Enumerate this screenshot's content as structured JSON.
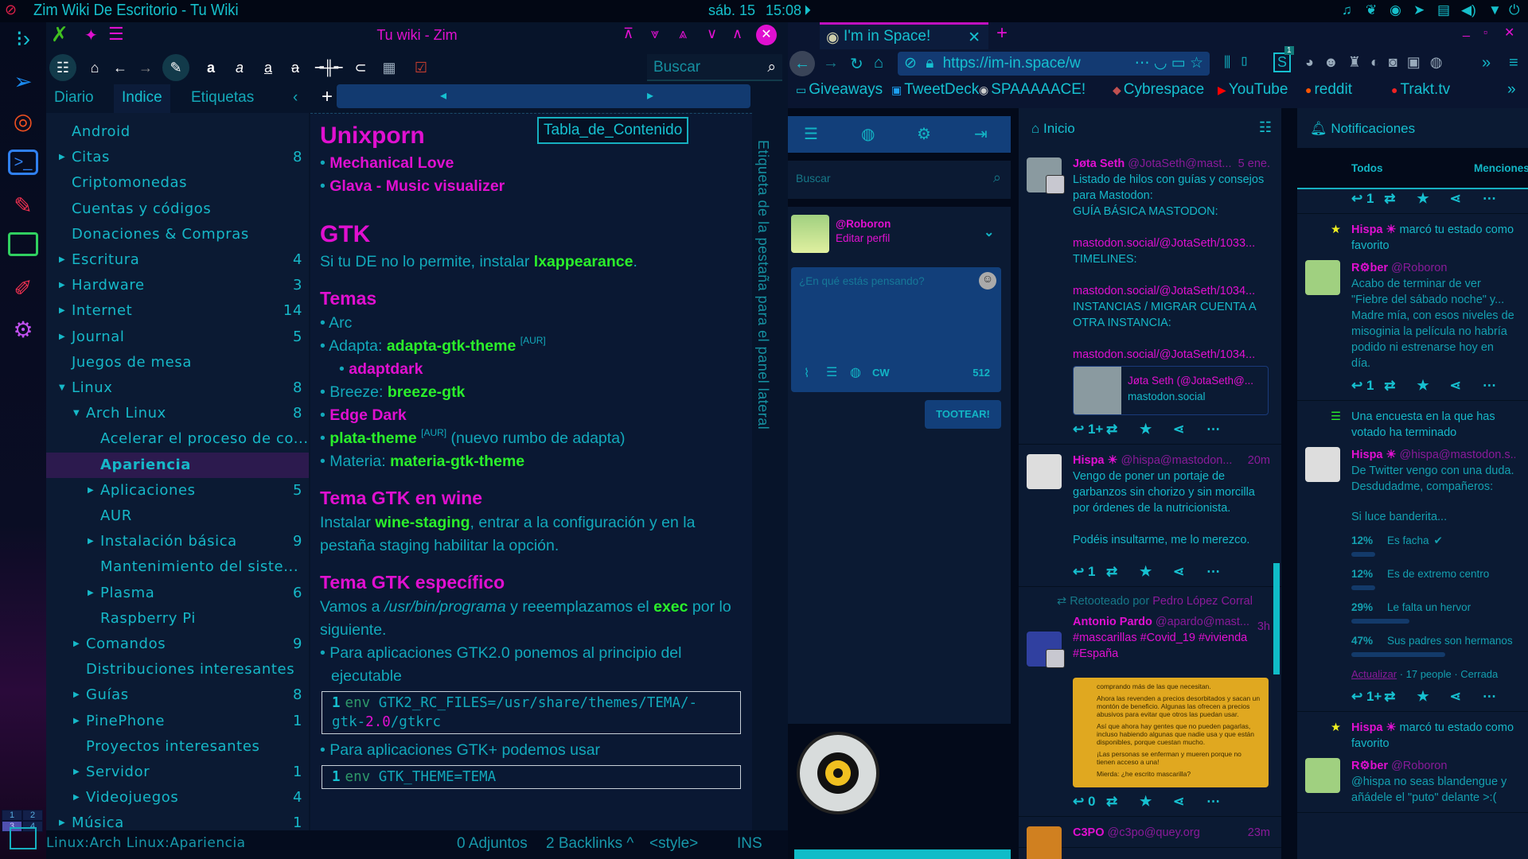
{
  "panel": {
    "window_title": "Zim Wiki De Escritorio - Tu Wiki",
    "date": "sáb. 15",
    "time": "15:08",
    "tray_icons": [
      "bell-icon",
      "feather-icon",
      "steam-icon",
      "telegram-icon",
      "clipboard-icon",
      "volume-icon",
      "network-icon",
      "power-icon"
    ]
  },
  "dock": {
    "icons": [
      "launcher-icon",
      "telegram-icon",
      "firefox-icon",
      "terminal-icon",
      "paint-icon",
      "folder-icon",
      "pencil-icon",
      "settings-icon"
    ],
    "workspaces": [
      "1",
      "2",
      "3",
      "4"
    ],
    "active_workspace": "3"
  },
  "zim": {
    "title": "Tu wiki - Zim",
    "search_placeholder": "Buscar",
    "tabs": [
      "Diario",
      "Indice",
      "Etiquetas"
    ],
    "active_tab": "Indice",
    "tree": [
      {
        "label": "Android",
        "count": "",
        "exp": "",
        "level": 0
      },
      {
        "label": "Citas",
        "count": "8",
        "exp": "right",
        "level": 0
      },
      {
        "label": "Criptomonedas",
        "count": "",
        "exp": "",
        "level": 0
      },
      {
        "label": "Cuentas y códigos",
        "count": "",
        "exp": "",
        "level": 0
      },
      {
        "label": "Donaciones & Compras",
        "count": "",
        "exp": "",
        "level": 0
      },
      {
        "label": "Escritura",
        "count": "4",
        "exp": "right",
        "level": 0
      },
      {
        "label": "Hardware",
        "count": "3",
        "exp": "right",
        "level": 0
      },
      {
        "label": "Internet",
        "count": "14",
        "exp": "right",
        "level": 0
      },
      {
        "label": "Journal",
        "count": "5",
        "exp": "right",
        "level": 0
      },
      {
        "label": "Juegos de mesa",
        "count": "",
        "exp": "",
        "level": 0
      },
      {
        "label": "Linux",
        "count": "8",
        "exp": "down",
        "level": 0
      },
      {
        "label": "Arch Linux",
        "count": "8",
        "exp": "down",
        "level": 1
      },
      {
        "label": "Acelerar el proceso de co...",
        "count": "",
        "exp": "",
        "level": 2
      },
      {
        "label": "Apariencia",
        "count": "",
        "exp": "",
        "level": 2,
        "selected": true
      },
      {
        "label": "Aplicaciones",
        "count": "5",
        "exp": "right",
        "level": 2
      },
      {
        "label": "AUR",
        "count": "",
        "exp": "",
        "level": 2
      },
      {
        "label": "Instalación básica",
        "count": "9",
        "exp": "right",
        "level": 2
      },
      {
        "label": "Mantenimiento del siste...",
        "count": "",
        "exp": "",
        "level": 2
      },
      {
        "label": "Plasma",
        "count": "6",
        "exp": "right",
        "level": 2
      },
      {
        "label": "Raspberry Pi",
        "count": "",
        "exp": "",
        "level": 2
      },
      {
        "label": "Comandos",
        "count": "9",
        "exp": "right",
        "level": 1
      },
      {
        "label": "Distribuciones interesantes",
        "count": "",
        "exp": "",
        "level": 1
      },
      {
        "label": "Guías",
        "count": "8",
        "exp": "right",
        "level": 1
      },
      {
        "label": "PinePhone",
        "count": "1",
        "exp": "right",
        "level": 1
      },
      {
        "label": "Proyectos interesantes",
        "count": "",
        "exp": "",
        "level": 1
      },
      {
        "label": "Servidor",
        "count": "1",
        "exp": "right",
        "level": 1
      },
      {
        "label": "Videojuegos",
        "count": "4",
        "exp": "right",
        "level": 1
      },
      {
        "label": "Música",
        "count": "1",
        "exp": "right",
        "level": 0
      }
    ],
    "toc_label": "Tabla_de_Contenido",
    "side_label": "Etiqueta de la pestaña para el panel lateral",
    "page": [
      {
        "type": "h1",
        "segs": [
          {
            "t": "Unixporn"
          }
        ]
      },
      {
        "type": "li",
        "segs": [
          {
            "t": "• "
          },
          {
            "t": "Mechanical Love",
            "s": "link"
          }
        ]
      },
      {
        "type": "li",
        "segs": [
          {
            "t": "• "
          },
          {
            "t": "Glava - Music visualizer",
            "s": "link"
          }
        ]
      },
      {
        "type": "gap",
        "segs": []
      },
      {
        "type": "h1",
        "segs": [
          {
            "t": "GTK"
          }
        ]
      },
      {
        "type": "p",
        "segs": [
          {
            "t": "Si tu DE no lo permite, instalar "
          },
          {
            "t": "lxappearance",
            "s": "pkg"
          },
          {
            "t": "."
          }
        ]
      },
      {
        "type": "h2",
        "segs": [
          {
            "t": "Temas"
          }
        ]
      },
      {
        "type": "li",
        "segs": [
          {
            "t": "• Arc"
          }
        ]
      },
      {
        "type": "li",
        "segs": [
          {
            "t": "• Adapta: "
          },
          {
            "t": "adapta-gtk-theme",
            "s": "pkg"
          },
          {
            "t": " "
          },
          {
            "t": "[AUR]",
            "s": "sup"
          }
        ]
      },
      {
        "type": "li2",
        "segs": [
          {
            "t": "• "
          },
          {
            "t": "adaptdark",
            "s": "link"
          }
        ]
      },
      {
        "type": "li",
        "segs": [
          {
            "t": "• Breeze: "
          },
          {
            "t": "breeze-gtk",
            "s": "pkg"
          }
        ]
      },
      {
        "type": "li",
        "segs": [
          {
            "t": "• "
          },
          {
            "t": "Edge Dark",
            "s": "link"
          }
        ]
      },
      {
        "type": "li",
        "segs": [
          {
            "t": "• "
          },
          {
            "t": "plata-theme",
            "s": "pkg"
          },
          {
            "t": " "
          },
          {
            "t": "[AUR]",
            "s": "sup"
          },
          {
            "t": " (nuevo rumbo de adapta)"
          }
        ]
      },
      {
        "type": "li",
        "segs": [
          {
            "t": "• Materia: "
          },
          {
            "t": "materia-gtk-theme",
            "s": "pkg"
          }
        ]
      },
      {
        "type": "h2",
        "segs": [
          {
            "t": "Tema GTK en wine"
          }
        ]
      },
      {
        "type": "p",
        "segs": [
          {
            "t": "Instalar "
          },
          {
            "t": "wine-staging",
            "s": "pkg"
          },
          {
            "t": ", entrar a la configuración y en la pestaña staging habilitar la opción."
          }
        ]
      },
      {
        "type": "h2",
        "segs": [
          {
            "t": "Tema GTK específico"
          }
        ]
      },
      {
        "type": "p",
        "segs": [
          {
            "t": "Vamos a "
          },
          {
            "t": "/usr/bin/programa",
            "s": "it"
          },
          {
            "t": " y reeemplazamos el "
          },
          {
            "t": "exec",
            "s": "pkg"
          },
          {
            "t": " por lo siguiente."
          }
        ]
      },
      {
        "type": "li",
        "segs": [
          {
            "t": "• Para aplicaciones GTK2.0 ponemos al principio del ejecutable"
          }
        ]
      },
      {
        "type": "code",
        "segs": [
          {
            "t": "1",
            "s": "ln"
          },
          {
            "t": "env",
            "s": "kw"
          },
          {
            "t": " GTK2_RC_FILES=/usr/share/themes/TEMA/-gtk-"
          },
          {
            "t": "2.0",
            "s": "mgn"
          },
          {
            "t": "/gtkrc"
          }
        ]
      },
      {
        "type": "li",
        "segs": [
          {
            "t": "• Para aplicaciones GTK+ podemos usar"
          }
        ]
      },
      {
        "type": "code",
        "segs": [
          {
            "t": "1",
            "s": "ln"
          },
          {
            "t": "env",
            "s": "kw"
          },
          {
            "t": " GTK_THEME=TEMA"
          }
        ]
      }
    ],
    "status": {
      "path": "Linux:Arch Linux:Apariencia",
      "attachments": "0 Adjuntos",
      "backlinks": "2 Backlinks ^",
      "style": "<style>",
      "mode": "INS"
    }
  },
  "firefox": {
    "tab_title": "I'm in Space!",
    "url": "https://im-in.space/w",
    "extension_badge": "1",
    "bookmarks": [
      "Giveaways",
      "TweetDeck",
      "SPAAAAACE!",
      "Cybrespace",
      "YouTube",
      "reddit",
      "Trakt.tv"
    ]
  },
  "mastodon": {
    "search_placeholder": "Buscar",
    "profile": {
      "handle": "@Roboron",
      "edit": "Editar perfil"
    },
    "compose": {
      "placeholder": "¿En qué estás pensando?",
      "cw": "CW",
      "chars": "512",
      "submit": "TOOTEAR!"
    },
    "home": {
      "title": "Inicio",
      "statuses": [
        {
          "name": "Jøta Seth",
          "acct": "@JotaSeth@mast...",
          "time": "5 ene.",
          "lines": [
            {
              "segs": [
                {
                  "t": "Listado de hilos con guías y consejos para Mastodon:"
                }
              ]
            },
            {
              "segs": [
                {
                  "t": "GUÍA BÁSICA MASTODON:"
                }
              ]
            },
            {
              "segs": [
                {
                  "t": "mastodon.social/@JotaSeth/1033...",
                  "s": "mg"
                }
              ]
            },
            {
              "segs": [
                {
                  "t": "TIMELINES:"
                }
              ]
            },
            {
              "segs": [
                {
                  "t": "mastodon.social/@JotaSeth/1034...",
                  "s": "mg"
                }
              ]
            },
            {
              "segs": [
                {
                  "t": "INSTANCIAS / MIGRAR CUENTA A OTRA INSTANCIA:"
                }
              ]
            },
            {
              "segs": [
                {
                  "t": "mastodon.social/@JotaSeth/1034...",
                  "s": "mg"
                }
              ]
            }
          ],
          "card": {
            "title": "Jøta Seth (@JotaSeth@...",
            "site": "mastodon.social"
          },
          "replies": "1+"
        },
        {
          "name": "Hispa ☀",
          "acct": "@hispa@mastodon...",
          "time": "20m",
          "lines": [
            {
              "segs": [
                {
                  "t": "Vengo de poner un portaje de garbanzos sin chorizo y sin morcilla por órdenes de la nutricionista."
                }
              ]
            },
            {
              "segs": [
                {
                  "t": "Podéis insultarme, me lo merezco."
                }
              ]
            }
          ],
          "replies": "1"
        },
        {
          "boosted_by_label": "Retooteado por",
          "boosted_by": "Pedro López Corral",
          "name": "Antonio Pardo",
          "acct": "@apardo@mast...",
          "time": "3h",
          "lines": [
            {
              "segs": [
                {
                  "t": "#mascarillas #Covid_19 #vivienda #España",
                  "s": "mg"
                }
              ]
            }
          ],
          "image_text": [
            "comprando más de las que necesitan.",
            "Ahora las revenden a precios desorbitados y sacan un montón de beneficio. Algunas las ofrecen a precios abusivos para evitar que otros las puedan usar.",
            "Así que ahora hay gentes que no pueden pagarlas, incluso habiendo algunas que nadie usa y que están disponibles, porque cuestan mucho.",
            "¡Las personas se enferman y mueren porque no tienen acceso a una!",
            "Mierda: ¿he escrito mascarilla?"
          ],
          "replies": "0"
        },
        {
          "name": "C3PO",
          "acct": "@c3po@quey.org",
          "time": "23m",
          "lines": []
        }
      ]
    },
    "notifications": {
      "title": "Notificaciones",
      "tabs": [
        "Todos",
        "Menciones"
      ],
      "top_replies": "1",
      "items": [
        {
          "kind": "favourite",
          "who": "Hispa ☀",
          "action": "marcó tu estado como favorito",
          "name": "R⚙ber",
          "acct": "@Roboron",
          "text": "Acabo de terminar de ver \"Fiebre del sábado noche\" y... Madre mía, con esos niveles de misoginia la película no habría podido ni estrenarse hoy en día.",
          "replies": "1"
        },
        {
          "kind": "poll",
          "action": "Una encuesta en la que has votado ha terminado",
          "name": "Hispa ☀",
          "acct": "@hispa@mastodon.s...",
          "text": "De Twitter vengo con una duda. Desdudadme, compañeros:",
          "question": "Si luce banderita...",
          "options": [
            {
              "pct": 12,
              "label": "Es facha",
              "voted": true
            },
            {
              "pct": 12,
              "label": "Es de extremo centro"
            },
            {
              "pct": 29,
              "label": "Le falta un hervor"
            },
            {
              "pct": 47,
              "label": "Sus padres son hermanos"
            }
          ],
          "refresh": "Actualizar",
          "meta": " · 17 people · Cerrada",
          "replies": "1+"
        },
        {
          "kind": "favourite",
          "who": "Hispa ☀",
          "action": "marcó tu estado como favorito",
          "name": "R⚙ber",
          "acct": "@Roboron",
          "text": "@hispa no seas blandengue y añádele el \"puto\" delante >:("
        }
      ]
    }
  },
  "colors": {
    "accent": "#e010d0",
    "text": "#12b5c5",
    "package": "#2bf02b",
    "panel": "#0b1a33",
    "column_header": "#123f7a"
  }
}
